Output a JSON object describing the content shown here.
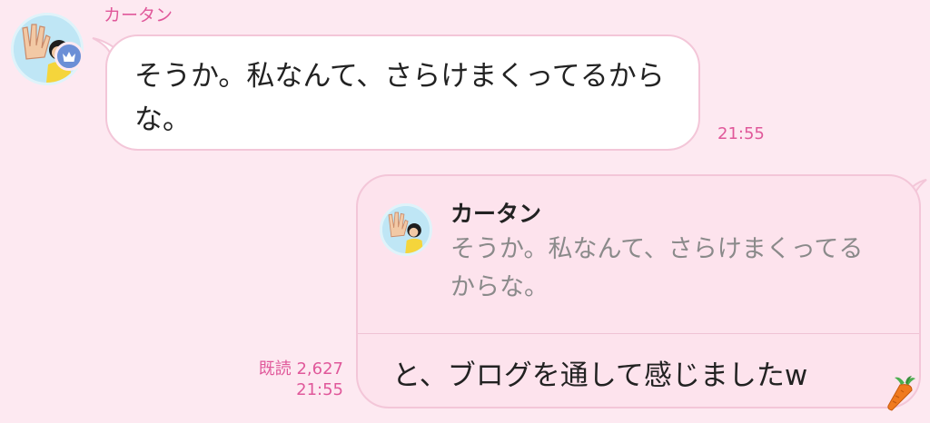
{
  "incoming": {
    "sender_name": "カータン",
    "text": "そうか。私なんて、さらけまくってるからな。",
    "time": "21:55",
    "avatar_icon": "waving-person-icon",
    "badge_icon": "crown-icon"
  },
  "outgoing": {
    "reply": {
      "name": "カータン",
      "text": "そうか。私なんて、さらけまくってるからな。",
      "avatar_icon": "waving-person-icon"
    },
    "text": "と、ブログを通して感じましたw",
    "read_status": "既読 2,627",
    "time": "21:55",
    "sticker_icon": "carrot-icon"
  },
  "colors": {
    "background": "#fde9f1",
    "accent": "#e0589a",
    "bubble_border": "#f3c6d8",
    "incoming_bubble": "#ffffff",
    "outgoing_bubble": "#fde3ed",
    "badge": "#6b8fd6"
  }
}
